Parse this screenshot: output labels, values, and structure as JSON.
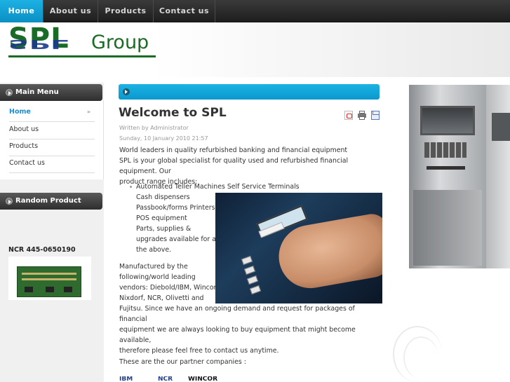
{
  "nav": {
    "items": [
      {
        "label": "Home",
        "active": true
      },
      {
        "label": "About us",
        "active": false
      },
      {
        "label": "Products",
        "active": false
      },
      {
        "label": "Contact us",
        "active": false
      }
    ]
  },
  "logo": {
    "brand": "SPL",
    "suffix": "Group"
  },
  "sidebar": {
    "main_menu_title": "Main Menu",
    "menu_items": [
      {
        "label": "Home",
        "active": true,
        "arrow": "»"
      },
      {
        "label": "About us",
        "active": false
      },
      {
        "label": "Products",
        "active": false
      },
      {
        "label": "Contact us",
        "active": false
      }
    ],
    "random_product_title": "Random Product",
    "product_name": "NCR 445-0650190"
  },
  "article": {
    "title": "Welcome to SPL",
    "author": "Written by Administrator",
    "date": "Sunday, 10 January 2010 21:57",
    "intro_lines": [
      "World leaders in quality refurbished banking and financial equipment",
      "SPL is your global specialist for quality used and refurbished financial equipment. Our",
      "product range includes:"
    ],
    "list_lines": [
      "Automated Teller Machines Self Service Terminals",
      "Cash dispensers",
      "Passbook/forms Printers",
      "POS equipment",
      "Parts, supplies &",
      "upgrades available for all",
      "the above."
    ],
    "manufacturer_lines": [
      "Manufactured by the",
      "following/world leading",
      "vendors: Diebold/IBM, Wincor",
      "Nixdorf, NCR, Olivetti and"
    ],
    "closing_lines": [
      "Fujitsu. Since we have an ongoing demand and request for packages of financial",
      "equipment we are always looking to buy equipment that might become available,",
      "therefore please feel free to contact us anytime."
    ],
    "partners_text": "These are the our partner companies :",
    "partner_logos": [
      "IBM",
      "NCR",
      "WINCOR"
    ]
  },
  "colors": {
    "accent": "#1aa8dc",
    "brand_green": "#1a6b25",
    "nav_bg": "#2a2a2a"
  },
  "icons": {
    "pdf": "pdf-icon",
    "print": "print-icon",
    "email": "email-icon"
  }
}
